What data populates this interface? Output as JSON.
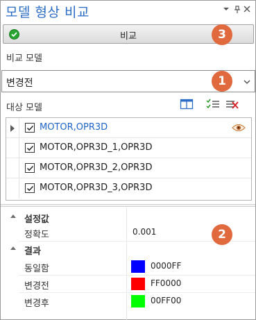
{
  "window": {
    "title": "모델 형상 비교"
  },
  "title_controls": [
    "▾",
    "📌",
    "✕"
  ],
  "compare_button": {
    "label": "비교",
    "badge": "3"
  },
  "source_model": {
    "label": "비교 모델",
    "selected": "변경전",
    "badge": "1"
  },
  "target_models": {
    "label": "대상 모델",
    "items": [
      {
        "label": "MOTOR,OPR3D",
        "checked": true,
        "highlighted": true
      },
      {
        "label": "MOTOR,OPR3D_1,OPR3D",
        "checked": true
      },
      {
        "label": "MOTOR,OPR3D_2,OPR3D",
        "checked": true
      },
      {
        "label": "MOTOR,OPR3D_3,OPR3D",
        "checked": true
      }
    ]
  },
  "properties": {
    "badge": "2",
    "settings": {
      "category": "설정값",
      "rows": [
        {
          "name": "정확도",
          "value": "0.001"
        }
      ]
    },
    "result": {
      "category": "결과",
      "rows": [
        {
          "name": "동일함",
          "value": "0000FF",
          "color": "#0000FF"
        },
        {
          "name": "변경전",
          "value": "FF0000",
          "color": "#FF0000"
        },
        {
          "name": "변경후",
          "value": "00FF00",
          "color": "#00FF00"
        }
      ]
    }
  },
  "colors": {
    "accent": "#2B6CC4",
    "badge": "#E0693E",
    "link": "#1E64C8"
  },
  "icons": [
    "check-circle-icon",
    "chevron-down-icon",
    "layout-icon",
    "check-list-icon",
    "clear-list-icon",
    "eye-icon"
  ]
}
